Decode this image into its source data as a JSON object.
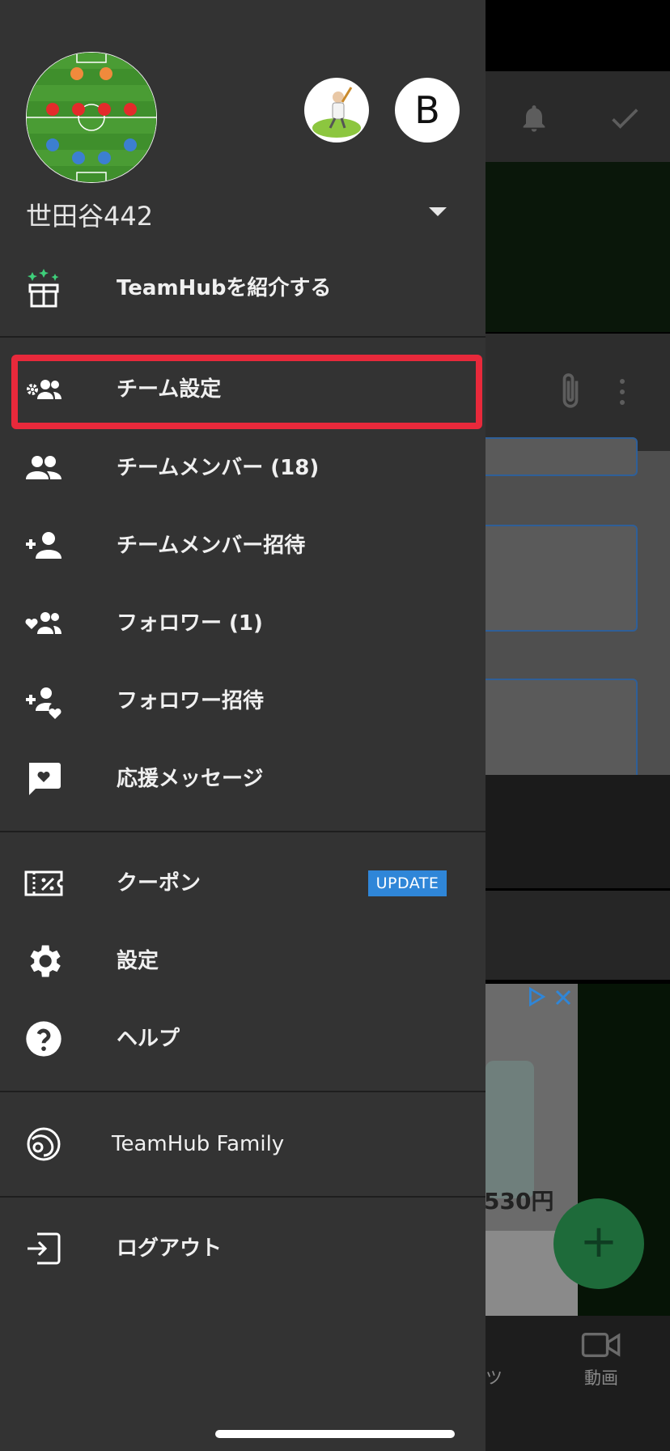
{
  "header": {
    "team_name": "世田谷442",
    "avatar_letter": "B"
  },
  "menu": {
    "introduce": "TeamHubを紹介する",
    "team_settings": "チーム設定",
    "team_members": "チームメンバー (18)",
    "invite_members": "チームメンバー招待",
    "followers": "フォロワー (1)",
    "invite_followers": "フォロワー招待",
    "cheer_messages": "応援メッセージ",
    "coupon": "クーポン",
    "coupon_badge": "UPDATE",
    "settings": "設定",
    "help": "ヘルプ",
    "family": "TeamHub Family",
    "logout": "ログアウト"
  },
  "background": {
    "ad_price": "530円",
    "nav_item_partial": "ツ",
    "nav_video": "動画",
    "fab": "+"
  },
  "colors": {
    "drawer_bg": "#333333",
    "highlight": "#e8293b",
    "badge": "#2f86d8",
    "gift_icon": "#3ecf7a"
  }
}
